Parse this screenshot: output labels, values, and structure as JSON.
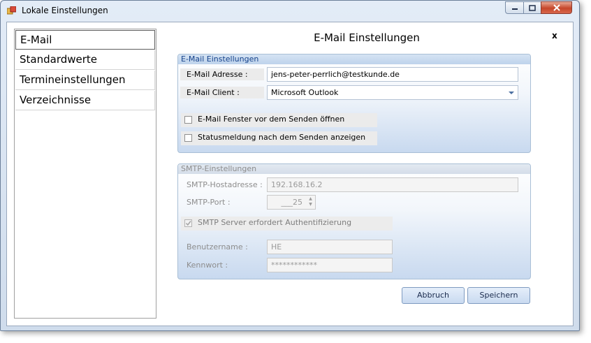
{
  "window": {
    "title": "Lokale Einstellungen"
  },
  "nav": {
    "items": [
      "E-Mail",
      "Standardwerte",
      "Termineinstellungen",
      "Verzeichnisse"
    ]
  },
  "panel": {
    "title": "E-Mail Einstellungen",
    "close": "x"
  },
  "email_group": {
    "header": "E-Mail Einstellungen",
    "address_label": "E-Mail Adresse :",
    "address_value": "jens-peter-perrlich@testkunde.de",
    "client_label": "E-Mail Client :",
    "client_value": "Microsoft Outlook",
    "open_window_label": "E-Mail Fenster vor dem Senden öffnen",
    "status_label": "Statusmeldung nach dem Senden anzeigen"
  },
  "smtp_group": {
    "header": "SMTP-Einstellungen",
    "host_label": "SMTP-Hostadresse :",
    "host_value": "192.168.16.2",
    "port_label": "SMTP-Port :",
    "port_value": "___25",
    "auth_label": "SMTP Server erfordert Authentifizierung",
    "auth_checked": true,
    "user_label": "Benutzername :",
    "user_value": "HE",
    "password_label": "Kennwort :",
    "password_value": "************"
  },
  "buttons": {
    "cancel": "Abbruch",
    "save": "Speichern"
  }
}
